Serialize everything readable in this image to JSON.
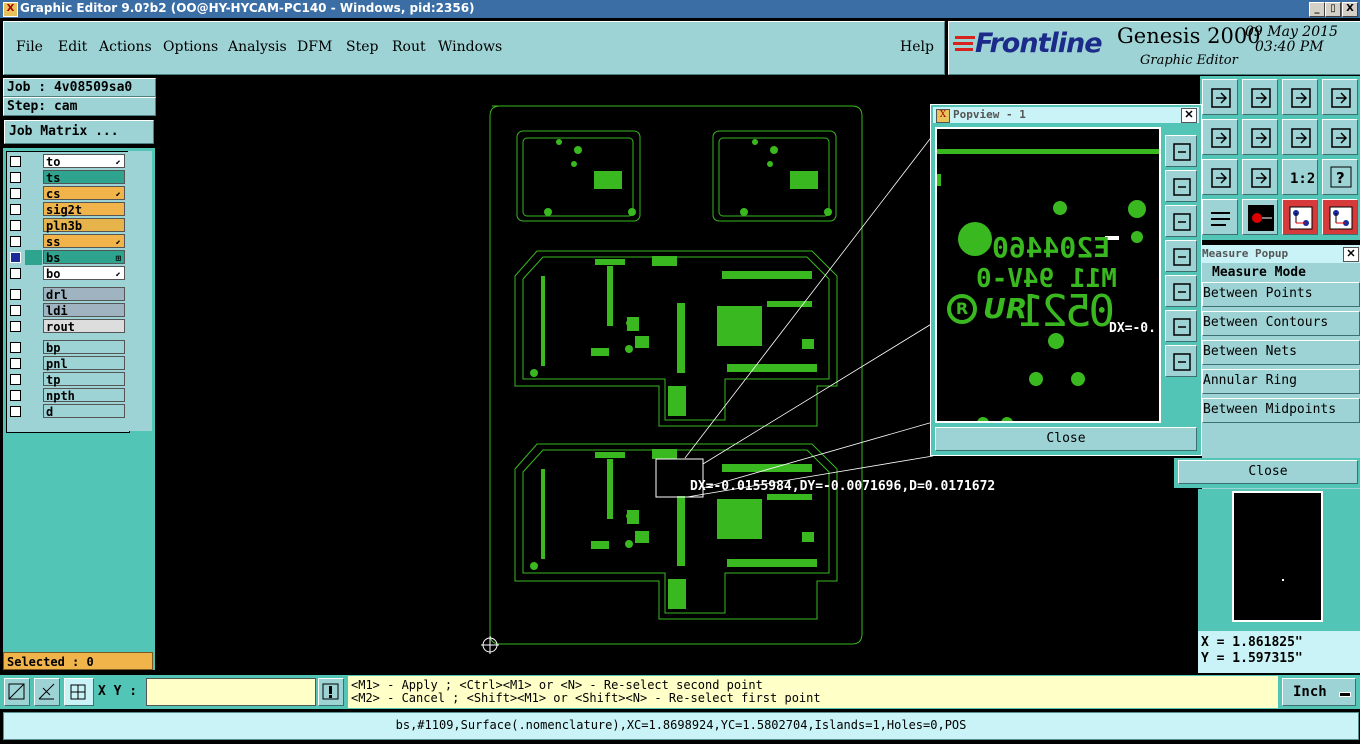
{
  "window": {
    "title": "Graphic Editor 9.0?b2 (OO@HY-HYCAM-PC140 - Windows, pid:2356)",
    "icon": "app-icon",
    "controls": [
      "_",
      "▯",
      "X"
    ]
  },
  "menu": {
    "items": [
      "File",
      "Edit",
      "Actions",
      "Options",
      "Analysis",
      "DFM",
      "Step",
      "Rout",
      "Windows"
    ],
    "help": "Help"
  },
  "brand": {
    "logo": "Frontline",
    "product": "Genesis 2000",
    "subtitle": "Graphic Editor",
    "date": "09 May 2015",
    "time": "03:40 PM"
  },
  "left": {
    "job": "Job : 4v08509sa0",
    "step": "Step: cam",
    "job_matrix": "Job Matrix ...",
    "selected": "Selected : 0"
  },
  "layers": [
    {
      "name": "to",
      "color": "#ffffff",
      "mark": "⬋"
    },
    {
      "name": "ts",
      "color": "#2ea38e",
      "mark": ""
    },
    {
      "name": "cs",
      "color": "#f0b44b",
      "mark": "⬋"
    },
    {
      "name": "sig2t",
      "color": "#f0b44b",
      "mark": ""
    },
    {
      "name": "pln3b",
      "color": "#e6b44a",
      "mark": ""
    },
    {
      "name": "ss",
      "color": "#f0b44b",
      "mark": "⬋"
    },
    {
      "name": "bs",
      "color": "#2ea38e",
      "mark": "⊞"
    },
    {
      "name": "bo",
      "color": "#ffffff",
      "mark": "⬋"
    },
    {
      "name": "drl",
      "color": "#9fb4c0",
      "mark": ""
    },
    {
      "name": "ldi",
      "color": "#9fb4c0",
      "mark": ""
    },
    {
      "name": "rout",
      "color": "#dddddd",
      "mark": ""
    },
    {
      "name": "bp",
      "color": "#9ed3d5",
      "mark": ""
    },
    {
      "name": "pnl",
      "color": "#9ed3d5",
      "mark": ""
    },
    {
      "name": "tp",
      "color": "#9ed3d5",
      "mark": ""
    },
    {
      "name": "npth",
      "color": "#9ed3d5",
      "mark": ""
    },
    {
      "name": "d",
      "color": "#9ed3d5",
      "mark": ""
    }
  ],
  "canvas": {
    "measure_text": "DX=-0.0155984,DY=-0.0071696,D=0.0171672",
    "trace_color": "#39b820"
  },
  "popview": {
    "title": "Popview - 1",
    "close": "Close",
    "pcb_text_1": "E204460",
    "pcb_text_2": "M11 94V-0",
    "pcb_text_3": "0521",
    "pcb_ul": "R",
    "pcb_ur": "UR",
    "pcb_dx": "DX=-0."
  },
  "measure": {
    "title": "Measure Popup",
    "mode_label": "Measure Mode",
    "modes": [
      "Between Points",
      "Between Contours",
      "Between Nets",
      "Annular Ring",
      "Between Midpoints"
    ],
    "close": "Close"
  },
  "coords": {
    "x": "X = 1.861825\"",
    "y": "Y = 1.597315\""
  },
  "bottom": {
    "xy_label": "X Y :",
    "xy_value": "",
    "hint_1": "<M1> - Apply  ; <Ctrl><M1> or <N> - Re-select second point",
    "hint_2": "<M2> - Cancel ; <Shift><M1> or <Shift><N> - Re-select first point",
    "unit": "Inch",
    "status": "bs,#1109,Surface(.nomenclature),XC=1.8698924,YC=1.5802704,Islands=1,Holes=0,POS"
  }
}
